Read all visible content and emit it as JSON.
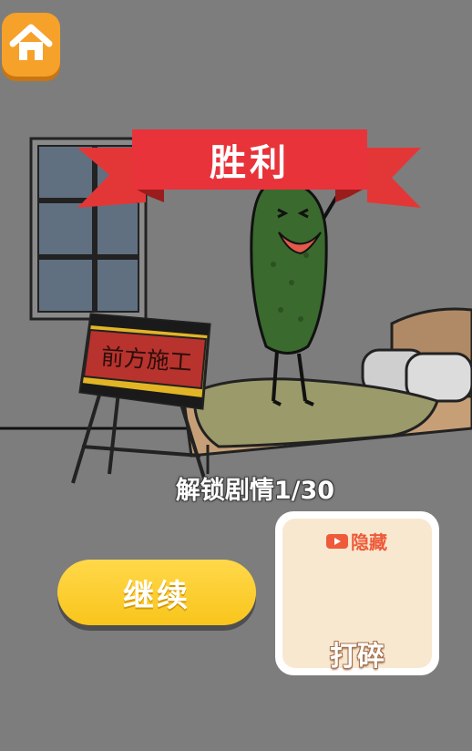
{
  "banner": {
    "title": "胜利"
  },
  "sign": {
    "text": "前方施工"
  },
  "progress": {
    "label": "解锁剧情1/30"
  },
  "actions": {
    "continue_label": "继续"
  },
  "hidden_card": {
    "tag": "隐藏",
    "action_label": "打碎"
  },
  "colors": {
    "background": "#7d7d7d",
    "banner_red": "#e8333b",
    "button_yellow": "#f9c51c",
    "home_orange": "#f5a12a",
    "card_cream": "#f8e8d0"
  },
  "icons": {
    "home": "home-icon",
    "video": "video-icon"
  }
}
